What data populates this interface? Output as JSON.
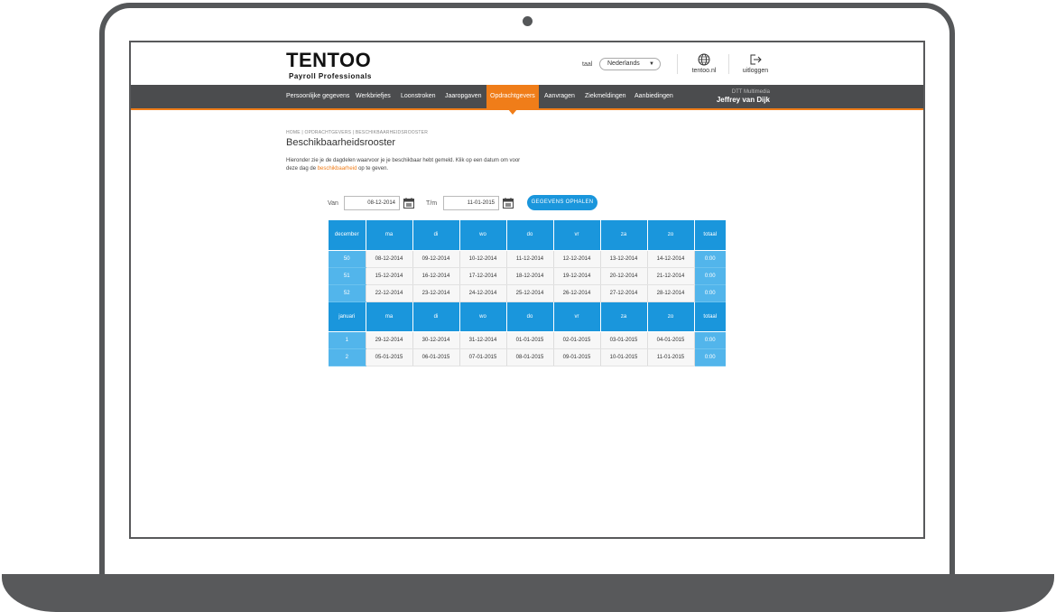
{
  "header": {
    "logo_title": "TENTOO",
    "logo_subtitle": "Payroll Professionals",
    "language_label": "taal",
    "language_selected": "Nederlands",
    "site_link_label": "tentoo.nl",
    "logout_label": "uitloggen"
  },
  "nav": {
    "items": [
      {
        "label": "Persoonlijke gegevens"
      },
      {
        "label": "Werkbriefjes"
      },
      {
        "label": "Loonstroken"
      },
      {
        "label": "Jaaropgaven"
      },
      {
        "label": "Opdrachtgevers"
      },
      {
        "label": "Aanvragen"
      },
      {
        "label": "Ziekmeldingen"
      },
      {
        "label": "Aanbiedingen"
      }
    ],
    "active": "Opdrachtgevers",
    "user_org": "DTT Multimedia",
    "user_name": "Jeffrey van Dijk"
  },
  "page": {
    "breadcrumb": "HOME | OPDRACHTGEVERS | BESCHIKBAARHEIDSROOSTER",
    "title": "Beschikbaarheidsrooster",
    "intro_before": "Hieronder zie je de dagdelen waarvoor je je beschikbaar hebt gemeld. Klik op een datum om voor deze dag de ",
    "intro_link": "beschikbaarheid",
    "intro_after": " op te geven."
  },
  "filter": {
    "from_label": "Van",
    "from_value": "08-12-2014",
    "to_label": "T/m",
    "to_value": "11-01-2015",
    "fetch_label": "GEGEVENS OPHALEN"
  },
  "schedule": {
    "day_headers": [
      "ma",
      "di",
      "wo",
      "do",
      "vr",
      "za",
      "zo"
    ],
    "total_header": "totaal",
    "months": [
      {
        "name": "december",
        "weeks": [
          {
            "week": "50",
            "dates": [
              "08-12-2014",
              "09-12-2014",
              "10-12-2014",
              "11-12-2014",
              "12-12-2014",
              "13-12-2014",
              "14-12-2014"
            ],
            "total": "0:00"
          },
          {
            "week": "51",
            "dates": [
              "15-12-2014",
              "16-12-2014",
              "17-12-2014",
              "18-12-2014",
              "19-12-2014",
              "20-12-2014",
              "21-12-2014"
            ],
            "total": "0:00"
          },
          {
            "week": "52",
            "dates": [
              "22-12-2014",
              "23-12-2014",
              "24-12-2014",
              "25-12-2014",
              "26-12-2014",
              "27-12-2014",
              "28-12-2014"
            ],
            "total": "0:00"
          }
        ]
      },
      {
        "name": "januari",
        "weeks": [
          {
            "week": "1",
            "dates": [
              "29-12-2014",
              "30-12-2014",
              "31-12-2014",
              "01-01-2015",
              "02-01-2015",
              "03-01-2015",
              "04-01-2015"
            ],
            "total": "0:00"
          },
          {
            "week": "2",
            "dates": [
              "05-01-2015",
              "06-01-2015",
              "07-01-2015",
              "08-01-2015",
              "09-01-2015",
              "10-01-2015",
              "11-01-2015"
            ],
            "total": "0:00"
          }
        ]
      }
    ]
  },
  "colors": {
    "accent_orange": "#f07d19",
    "accent_blue": "#1a96dc",
    "nav_bg": "#4b4c4e"
  }
}
